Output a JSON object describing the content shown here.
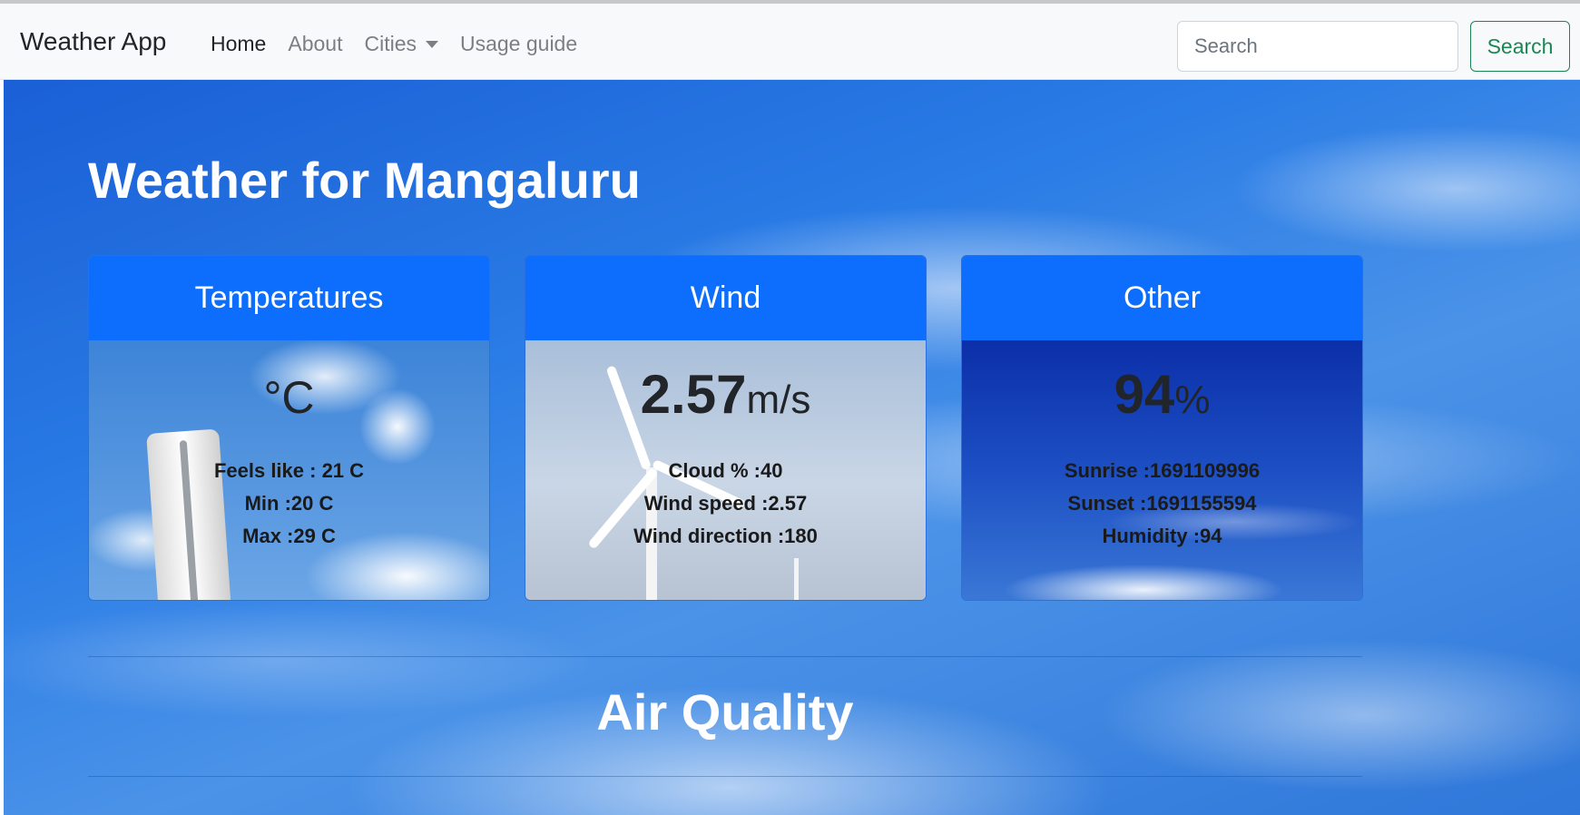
{
  "navbar": {
    "brand": "Weather App",
    "links": [
      {
        "label": "Home",
        "active": true
      },
      {
        "label": "About",
        "active": false
      },
      {
        "label": "Cities",
        "active": false,
        "dropdown": true
      },
      {
        "label": "Usage guide",
        "active": false
      }
    ],
    "search_placeholder": "Search",
    "search_button": "Search"
  },
  "page": {
    "title": "Weather for Mangaluru",
    "air_quality_title": "Air Quality"
  },
  "cards": {
    "temperatures": {
      "title": "Temperatures",
      "value": "",
      "unit": "°C",
      "feels_like": "Feels like : 21 C",
      "min": "Min :20 C",
      "max": "Max :29 C"
    },
    "wind": {
      "title": "Wind",
      "value": "2.57",
      "unit": "m/s",
      "cloud": "Cloud % :40",
      "wind_speed": "Wind speed :2.57",
      "wind_direction": "Wind direction :180"
    },
    "other": {
      "title": "Other",
      "value": "94",
      "unit": "%",
      "sunrise": "Sunrise :1691109996",
      "sunset": "Sunset :1691155594",
      "humidity": "Humidity :94"
    }
  },
  "colors": {
    "card_header": "#0d6efd",
    "search_button": "#198754"
  }
}
